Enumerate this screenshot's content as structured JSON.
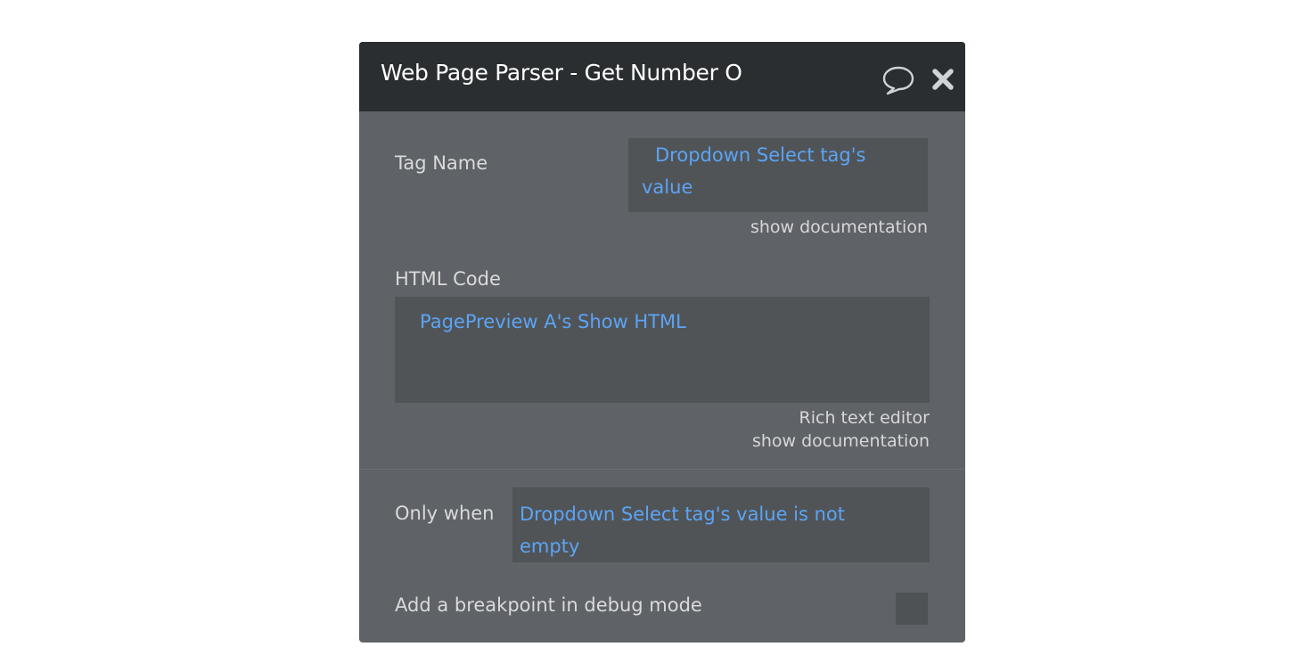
{
  "header": {
    "title": "Web Page Parser - Get Number O",
    "comment_icon": "speech-bubble-icon",
    "close_icon": "close-x-icon"
  },
  "fields": {
    "tag_name": {
      "label": "Tag Name",
      "value_line1": "Dropdown Select tag's",
      "value_line2": "value",
      "doc_link": "show documentation"
    },
    "html_code": {
      "label": "HTML Code",
      "value": "PagePreview A's Show HTML",
      "rich_text_link": "Rich text editor",
      "doc_link": "show documentation"
    }
  },
  "condition": {
    "label": "Only when",
    "value_line1": "Dropdown Select tag's value is not",
    "value_line2": "empty"
  },
  "breakpoint": {
    "label": "Add a breakpoint in debug mode",
    "checked": false
  },
  "colors": {
    "panel_bg": "#5f6266",
    "titlebar_bg": "#2a2e30",
    "input_bg": "#515457",
    "dynamic_text": "#5ba4f5",
    "label_text": "#d9dadb"
  }
}
